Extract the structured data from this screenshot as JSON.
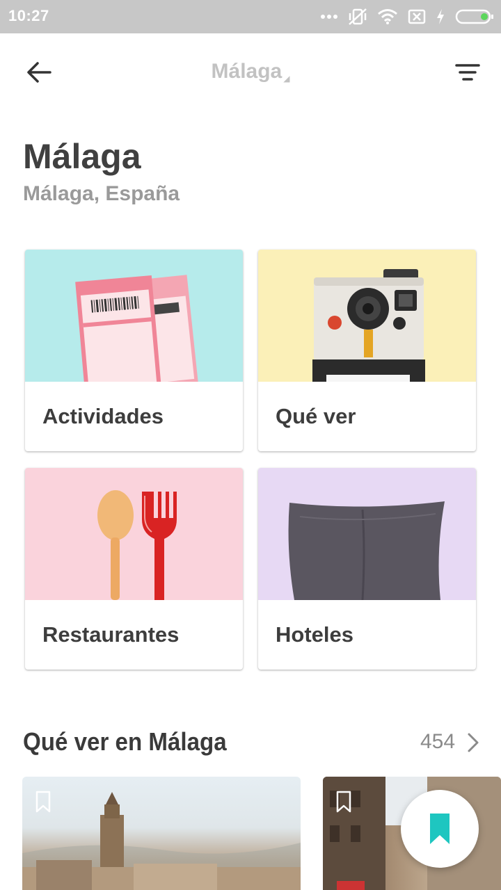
{
  "status_bar": {
    "time": "10:27",
    "icons": [
      "more-dots-icon",
      "vibrate-off-icon",
      "wifi-icon",
      "no-sim-icon",
      "charging-bolt-icon",
      "battery-icon"
    ]
  },
  "app_bar": {
    "back_icon": "arrow-left-icon",
    "title": "Málaga",
    "title_caret": "◢",
    "filter_icon": "filter-icon"
  },
  "header": {
    "title": "Málaga",
    "subtitle": "Málaga, España"
  },
  "categories": [
    {
      "label": "Actividades",
      "image": "tickets",
      "bg": "#b6ebeb"
    },
    {
      "label": "Qué ver",
      "image": "instant-camera",
      "bg": "#fbf0b8"
    },
    {
      "label": "Restaurantes",
      "image": "spoon-and-fork",
      "bg": "#fad3dc"
    },
    {
      "label": "Hoteles",
      "image": "pillow",
      "bg": "#e7d9f4"
    }
  ],
  "section": {
    "title": "Qué ver en Málaga",
    "count": "454",
    "chevron_icon": "chevron-right-icon"
  },
  "places": [
    {
      "image": "malaga-cathedral",
      "bookmark_icon": "bookmark-outline-icon"
    },
    {
      "image": "malaga-street",
      "bookmark_icon": "bookmark-outline-icon"
    }
  ],
  "fab": {
    "icon": "bookmark-icon",
    "color": "#1ec6c0"
  },
  "colors": {
    "status_bar_bg": "#c7c7c7",
    "title_text": "#404040",
    "subtitle_text": "#9a9a9a",
    "accent": "#1ec6c0"
  }
}
